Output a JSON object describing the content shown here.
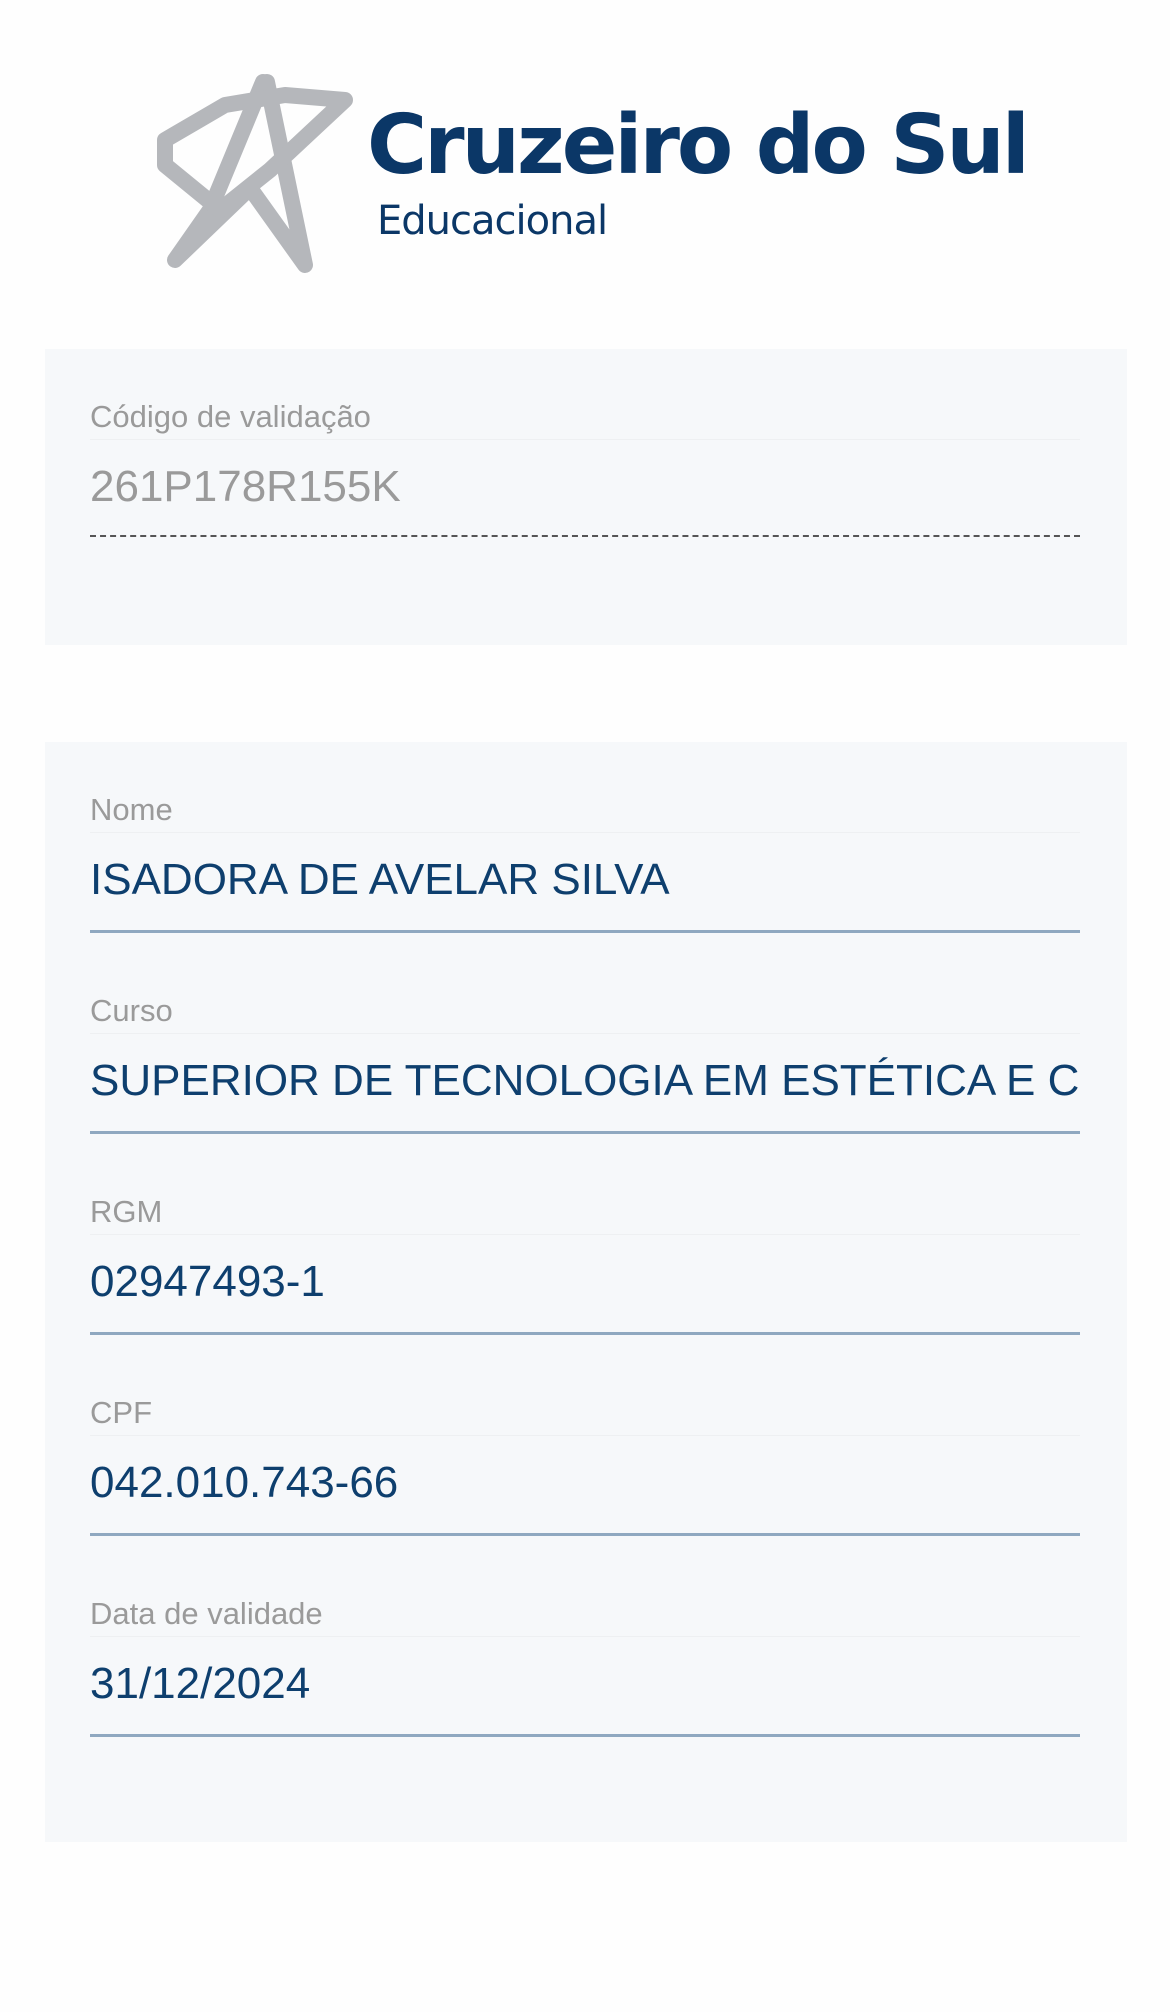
{
  "logo": {
    "title": "Cruzeiro do Sul",
    "subtitle": "Educacional",
    "star_color": "#b5b7bb",
    "brand_color": "#0b3767"
  },
  "validation": {
    "label": "Código de validação",
    "value": "261P178R155K"
  },
  "fields": [
    {
      "label": "Nome",
      "value": "ISADORA DE AVELAR SILVA"
    },
    {
      "label": "Curso",
      "value": "SUPERIOR DE TECNOLOGIA EM ESTÉTICA E COSMÉTICA"
    },
    {
      "label": "RGM",
      "value": "02947493-1"
    },
    {
      "label": "CPF",
      "value": "042.010.743-66"
    },
    {
      "label": "Data de validade",
      "value": "31/12/2024"
    }
  ]
}
